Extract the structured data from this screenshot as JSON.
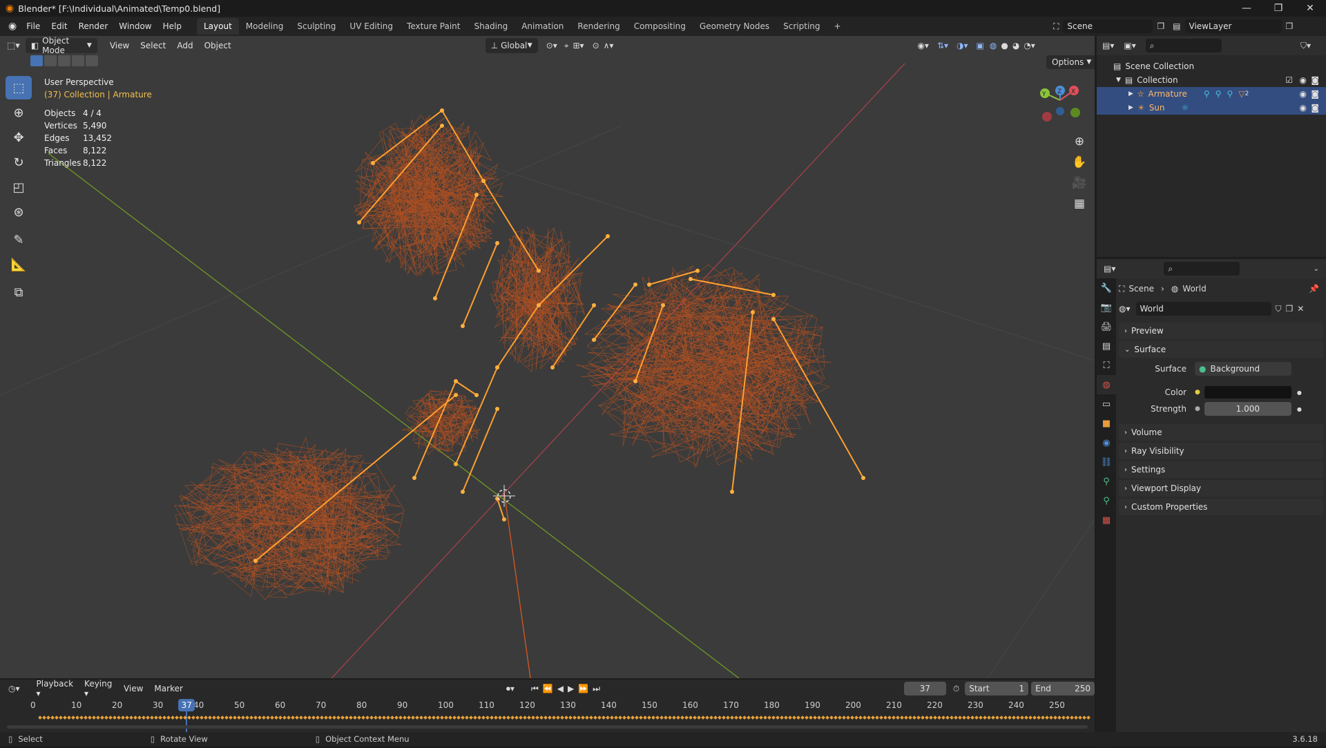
{
  "window": {
    "title": "Blender* [F:\\Individual\\Animated\\Temp0.blend]"
  },
  "menu": [
    "File",
    "Edit",
    "Render",
    "Window",
    "Help"
  ],
  "workspaces": [
    "Layout",
    "Modeling",
    "Sculpting",
    "UV Editing",
    "Texture Paint",
    "Shading",
    "Animation",
    "Rendering",
    "Compositing",
    "Geometry Nodes",
    "Scripting"
  ],
  "scene_name": "Scene",
  "view_layer": "ViewLayer",
  "viewport_header": {
    "mode": "Object Mode",
    "menus": [
      "View",
      "Select",
      "Add",
      "Object"
    ],
    "orientation": "Global",
    "options": "Options"
  },
  "viewport_info": {
    "perspective": "User Perspective",
    "collection": "(37) Collection | ",
    "active_object": "Armature"
  },
  "stats": [
    {
      "label": "Objects",
      "value": "4 / 4"
    },
    {
      "label": "Vertices",
      "value": "5,490"
    },
    {
      "label": "Edges",
      "value": "13,452"
    },
    {
      "label": "Faces",
      "value": "8,122"
    },
    {
      "label": "Triangles",
      "value": "8,122"
    }
  ],
  "gizmo": {
    "y": "Y",
    "z": "Z",
    "x": "X"
  },
  "outliner": {
    "root": "Scene Collection",
    "collection": "Collection",
    "items": [
      {
        "name": "Armature",
        "color": "#e89a3c",
        "badge": "2"
      },
      {
        "name": "Sun",
        "color": "#e89a3c"
      }
    ]
  },
  "properties": {
    "breadcrumb_scene": "Scene",
    "breadcrumb_world": "World",
    "world_name": "World",
    "panels_top": [
      "Preview"
    ],
    "surface_panel": "Surface",
    "surface": {
      "label": "Surface",
      "value": "Background"
    },
    "color": {
      "label": "Color"
    },
    "strength": {
      "label": "Strength",
      "value": "1.000"
    },
    "panels_bottom": [
      "Volume",
      "Ray Visibility",
      "Settings",
      "Viewport Display",
      "Custom Properties"
    ]
  },
  "timeline": {
    "menus": [
      "Playback",
      "Keying",
      "View",
      "Marker"
    ],
    "current_frame": "37",
    "start_label": "Start",
    "start": "1",
    "end_label": "End",
    "end": "250",
    "ticks": [
      "0",
      "10",
      "20",
      "30",
      "40",
      "50",
      "60",
      "70",
      "80",
      "90",
      "100",
      "110",
      "120",
      "130",
      "140",
      "150",
      "160",
      "170",
      "180",
      "190",
      "200",
      "210",
      "220",
      "230",
      "240",
      "250"
    ],
    "playhead": "37"
  },
  "status": {
    "select": "Select",
    "rotate": "Rotate View",
    "context": "Object Context Menu",
    "version": "3.6.18"
  },
  "colors": {
    "accent": "#4772b3",
    "wire": "#c8541c",
    "bone": "#ffa030",
    "x_axis": "#a5404a",
    "y_axis": "#6f9a23"
  }
}
